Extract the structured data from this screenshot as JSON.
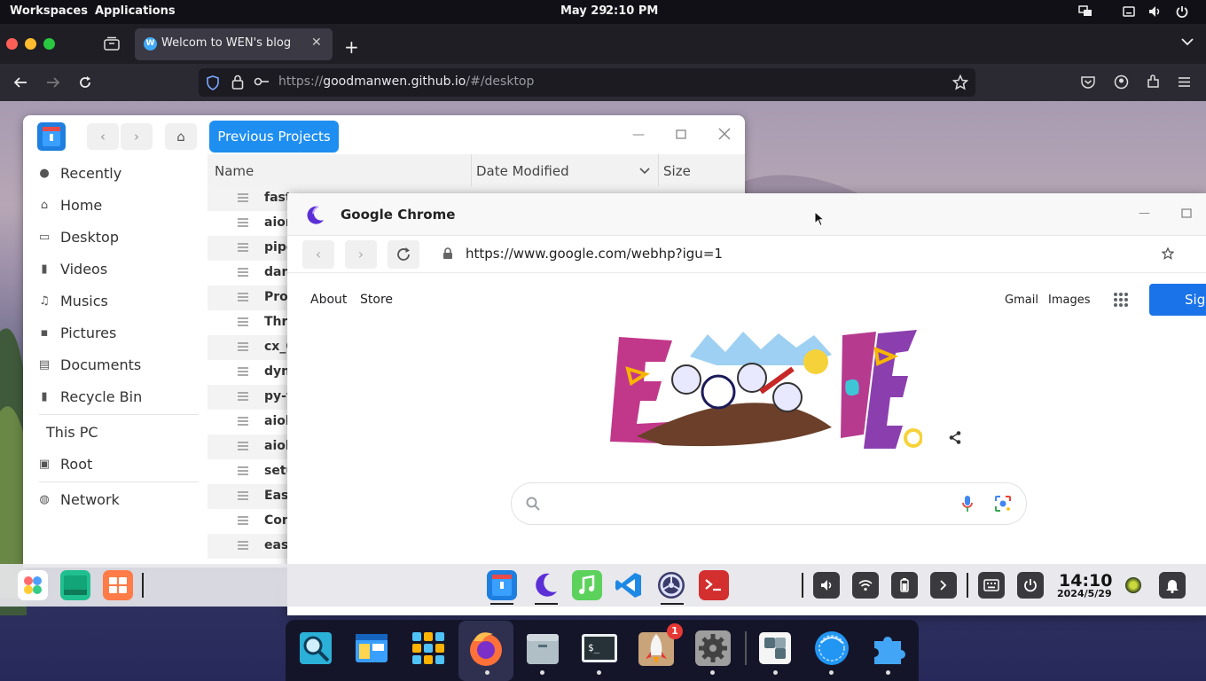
{
  "topbar": {
    "workspaces": "Workspaces",
    "applications": "Applications",
    "date": "May 29",
    "time": "2:10 PM"
  },
  "firefox": {
    "tab_title": "Welcom to WEN's blog",
    "tab_favicon": "W",
    "url_prefix": "https://",
    "url_host": "goodmanwen.github.io",
    "url_path": "/#/desktop"
  },
  "file_manager": {
    "previous_button": "Previous Projects",
    "sidebar": [
      {
        "label": "Recently",
        "icon": "clock-icon"
      },
      {
        "label": "Home",
        "icon": "home-icon"
      },
      {
        "label": "Desktop",
        "icon": "desktop-icon"
      },
      {
        "label": "Videos",
        "icon": "video-icon"
      },
      {
        "label": "Musics",
        "icon": "music-icon"
      },
      {
        "label": "Pictures",
        "icon": "picture-icon"
      },
      {
        "label": "Documents",
        "icon": "document-icon"
      },
      {
        "label": "Recycle Bin",
        "icon": "trash-icon"
      },
      {
        "label": "This PC",
        "icon": ""
      },
      {
        "label": "Root",
        "icon": "drive-icon"
      },
      {
        "label": "Network",
        "icon": "globe-icon"
      }
    ],
    "columns": {
      "name": "Name",
      "date": "Date Modified",
      "size": "Size"
    },
    "rows": [
      "fast",
      "aior",
      "pipe",
      "dan",
      "Prog",
      "Thre",
      "cx_C",
      "dyn",
      "py-f",
      "aioh",
      "aioh",
      "setu",
      "Easy",
      "Con",
      "easy"
    ]
  },
  "chrome": {
    "title": "Google Chrome",
    "url": "https://www.google.com/webhp?igu=1",
    "links_left": [
      "About",
      "Store"
    ],
    "gmail": "Gmail",
    "images": "Images",
    "signin": "Sign"
  },
  "taskbar": {
    "clock_time": "14:10",
    "clock_date": "2024/5/29"
  },
  "dock": {
    "badge": "1"
  }
}
